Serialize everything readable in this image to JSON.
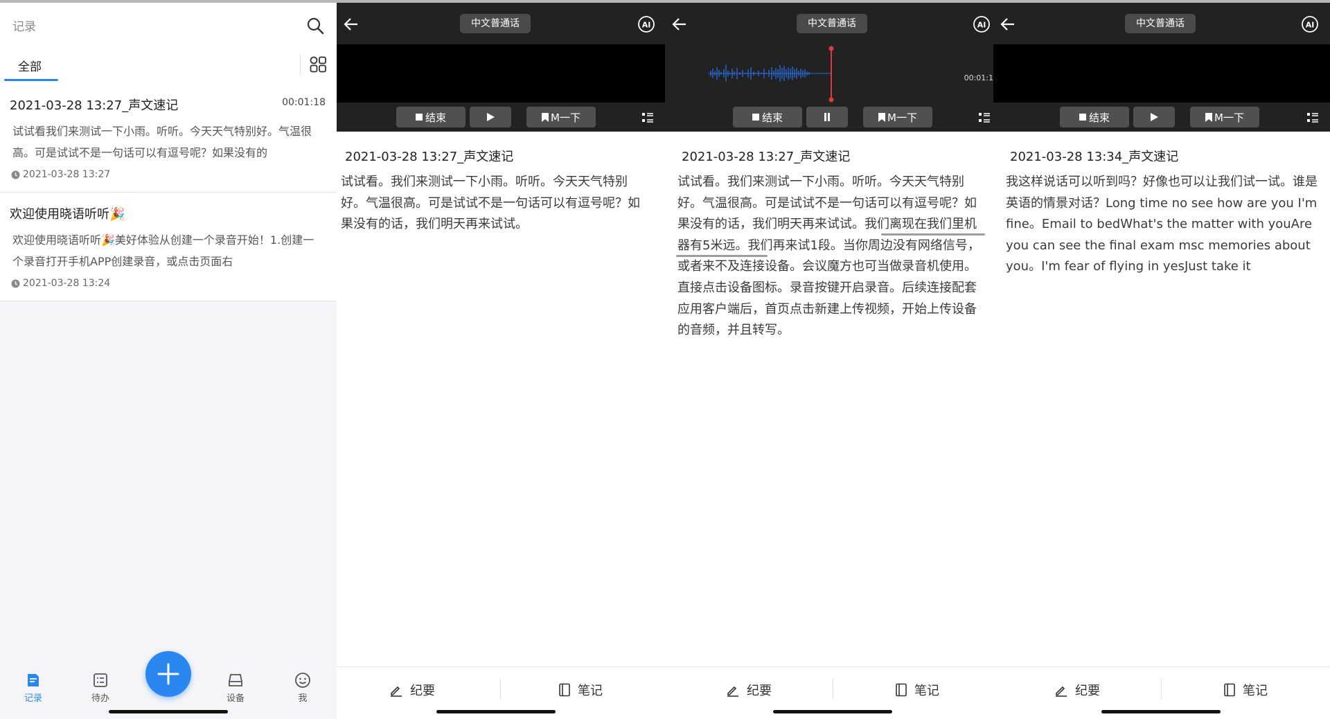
{
  "list": {
    "title": "记录",
    "tab_all": "全部",
    "records": [
      {
        "title": "2021-03-28 13:27_声文速记",
        "duration": "00:01:18",
        "preview": "试试看我们来测试一下小雨。听听。今天天气特别好。气温很高。可是试试不是一句话可以有逗号呢？如果没有的",
        "time": "2021-03-28 13:27"
      },
      {
        "title": "欢迎使用晓语听听🎉",
        "duration": "",
        "preview": "欢迎使用晓语听听🎉美好体验从创建一个录音开始！1.创建一个录音打开手机APP创建录音，或点击页面右",
        "time": "2021-03-28 13:24"
      }
    ],
    "nav": {
      "records": "记录",
      "todo": "待办",
      "device": "设备",
      "me": "我"
    }
  },
  "panels": [
    {
      "lang": "中文普通话",
      "stop": "结束",
      "mark": "M一下",
      "timer": "",
      "title": "2021-03-28 13:27_声文速记",
      "body": "试试看。我们来测试一下小雨。听听。今天天气特别好。气温很高。可是试试不是一句话可以有逗号呢？如果没有的话，我们明天再来试试。",
      "summary": "纪要",
      "notes": "笔记"
    },
    {
      "lang": "中文普通话",
      "stop": "结束",
      "mark": "M一下",
      "timer": "00:01:1",
      "title": "2021-03-28 13:27_声文速记",
      "body": "试试看。我们来测试一下小雨。听听。今天天气特别好。气温很高。可是试试不是一句话可以有逗号呢？如果没有的话，我们明天再来试试。我们离现在我们里机器有5米远。我们再来试1段。当你周边没有网络信号，或者来不及连接设备。会议魔方也可当做录音机使用。直接点击设备图标。录音按键开启录音。后续连接配套应用客户端后，首页点击新建上传视频，开始上传设备的音频，并且转写。",
      "summary": "纪要",
      "notes": "笔记"
    },
    {
      "lang": "中文普通话",
      "stop": "结束",
      "mark": "M一下",
      "timer": "",
      "title": "2021-03-28 13:34_声文速记",
      "body": "我这样说话可以听到吗？好像也可以让我们试一试。谁是英语的情景对话？Long time no see how are you I'm fine。Email to bedWhat's the matter with youAre you can see the final exam msc memories about you。I'm fear of flying in yesJust take it",
      "summary": "纪要",
      "notes": "笔记"
    }
  ],
  "colors": {
    "accent": "#2a86f0",
    "header": "#222222",
    "wave": "#2a6be0",
    "playhead": "#e03b3b"
  }
}
